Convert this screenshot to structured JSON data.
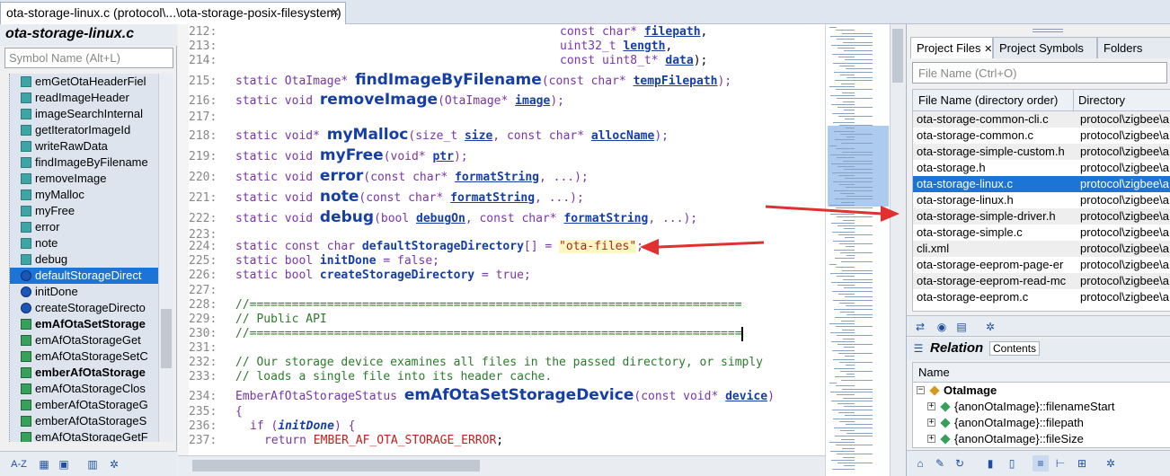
{
  "tab": {
    "title": "ota-storage-linux.c (protocol\\...\\ota-storage-posix-filesystem)",
    "close": "✕"
  },
  "left": {
    "title": "ota-storage-linux.c",
    "search_placeholder": "Symbol Name (Alt+L)",
    "symbols": [
      {
        "label": "emGetOtaHeaderFiel",
        "icon": "teal"
      },
      {
        "label": "readImageHeader",
        "icon": "teal"
      },
      {
        "label": "imageSearchInternal",
        "icon": "teal"
      },
      {
        "label": "getIteratorImageId",
        "icon": "teal"
      },
      {
        "label": "writeRawData",
        "icon": "teal"
      },
      {
        "label": "findImageByFilename",
        "icon": "teal"
      },
      {
        "label": "removeImage",
        "icon": "teal"
      },
      {
        "label": "myMalloc",
        "icon": "teal"
      },
      {
        "label": "myFree",
        "icon": "teal"
      },
      {
        "label": "error",
        "icon": "teal"
      },
      {
        "label": "note",
        "icon": "teal"
      },
      {
        "label": "debug",
        "icon": "teal"
      },
      {
        "label": "defaultStorageDirect",
        "icon": "blue",
        "selected": true
      },
      {
        "label": "initDone",
        "icon": "blue"
      },
      {
        "label": "createStorageDirecto",
        "icon": "blue"
      },
      {
        "label": "emAfOtaSetStorage",
        "icon": "green",
        "bold": true
      },
      {
        "label": "emAfOtaStorageGet",
        "icon": "green"
      },
      {
        "label": "emAfOtaStorageSetC",
        "icon": "green"
      },
      {
        "label": "emberAfOtaStorage",
        "icon": "green",
        "bold": true
      },
      {
        "label": "emAfOtaStorageClos",
        "icon": "green"
      },
      {
        "label": "emberAfOtaStorageG",
        "icon": "green"
      },
      {
        "label": "emberAfOtaStorageS",
        "icon": "green"
      },
      {
        "label": "emAfOtaStorageGetF",
        "icon": "green"
      }
    ],
    "toolbar": {
      "az": "A-Z"
    }
  },
  "code": {
    "l212": {
      "num": "212:",
      "text": "const char* ",
      "param": "filepath",
      "tail": ","
    },
    "l213": {
      "num": "213:",
      "text": "uint32_t ",
      "param": "length",
      "tail": ","
    },
    "l214": {
      "num": "214:",
      "text": "const uint8_t* ",
      "param": "data",
      "tail": ");"
    },
    "l215": {
      "num": "215:",
      "kw": "static OtaImage* ",
      "fn": "findImageByFilename",
      "open": "(",
      "args": "const char* ",
      "param": "tempFilepath",
      "tail": ");"
    },
    "l216": {
      "num": "216:",
      "kw": "static void ",
      "fn": "removeImage",
      "open": "(",
      "args": "OtaImage* ",
      "param": "image",
      "tail": ");"
    },
    "l217": {
      "num": "217:"
    },
    "l218": {
      "num": "218:",
      "kw": "static void* ",
      "fn": "myMalloc",
      "open": "(",
      "args": "size_t ",
      "param": "size",
      "mid": ", const char* ",
      "param2": "allocName",
      "tail": ");"
    },
    "l219": {
      "num": "219:",
      "kw": "static void ",
      "fn": "myFree",
      "open": "(",
      "args": "void* ",
      "param": "ptr",
      "tail": ");"
    },
    "l220": {
      "num": "220:",
      "kw": "static void ",
      "fn": "error",
      "open": "(",
      "args": "const char* ",
      "param": "formatString",
      "tail": ", ...);"
    },
    "l221": {
      "num": "221:",
      "kw": "static void ",
      "fn": "note",
      "open": "(",
      "args": "const char* ",
      "param": "formatString",
      "tail": ", ...);"
    },
    "l222": {
      "num": "222:",
      "kw": "static void ",
      "fn": "debug",
      "open": "(",
      "args": "bool ",
      "param": "debugOn",
      "mid": ", const char* ",
      "param2": "formatString",
      "tail": ", ...);"
    },
    "l223": {
      "num": "223:"
    },
    "l224": {
      "num": "224:",
      "kw": "static const char ",
      "name": "defaultStorageDirectory",
      "mid": "[] = ",
      "str": "\"ota-files\"",
      "tail": ";"
    },
    "l225": {
      "num": "225:",
      "kw": "static bool ",
      "name": "initDone",
      "tail": " = false;"
    },
    "l226": {
      "num": "226:",
      "kw": "static bool ",
      "name": "createStorageDirectory",
      "tail": " = true;"
    },
    "l227": {
      "num": "227:"
    },
    "l228": {
      "num": "228:",
      "cm": "//======================================================================"
    },
    "l229": {
      "num": "229:",
      "cm": "// Public API"
    },
    "l230": {
      "num": "230:",
      "cm": "//======================================================================"
    },
    "l231": {
      "num": "231:"
    },
    "l232": {
      "num": "232:",
      "cm": "// Our storage device examines all files in the passed directory, or simply"
    },
    "l233": {
      "num": "233:",
      "cm": "// loads a single file into its header cache."
    },
    "l234": {
      "num": "234:",
      "kw": "EmberAfOtaStorageStatus ",
      "fn": "emAfOtaSetStorageDevice",
      "open": "(",
      "args": "const void* ",
      "param": "device",
      "tail": ")"
    },
    "l235": {
      "num": "235:",
      "text": "{"
    },
    "l236": {
      "num": "236:",
      "kw": "if ",
      "open": "(",
      "bi": "initDone",
      "tail": ") {"
    },
    "l237": {
      "num": "237:",
      "kw": "return ",
      "cst": "EMBER_AF_OTA_STORAGE_ERROR",
      "tail": ";"
    }
  },
  "right": {
    "tabs": [
      "Project Files",
      "Project Symbols",
      "Folders"
    ],
    "tab_close": "✕",
    "search_placeholder": "File Name (Ctrl+O)",
    "columns": [
      "File Name (directory order)",
      "Directory"
    ],
    "files": [
      {
        "name": "ota-storage-common-cli.c",
        "dir": "protocol\\zigbee\\a"
      },
      {
        "name": "ota-storage-common.c",
        "dir": "protocol\\zigbee\\a"
      },
      {
        "name": "ota-storage-simple-custom.h",
        "dir": "protocol\\zigbee\\a"
      },
      {
        "name": "ota-storage.h",
        "dir": "protocol\\zigbee\\a"
      },
      {
        "name": "ota-storage-linux.c",
        "dir": "protocol\\zigbee\\a",
        "selected": true
      },
      {
        "name": "ota-storage-linux.h",
        "dir": "protocol\\zigbee\\a"
      },
      {
        "name": "ota-storage-simple-driver.h",
        "dir": "protocol\\zigbee\\a"
      },
      {
        "name": "ota-storage-simple.c",
        "dir": "protocol\\zigbee\\a"
      },
      {
        "name": "cli.xml",
        "dir": "protocol\\zigbee\\a"
      },
      {
        "name": "ota-storage-eeprom-page-er",
        "dir": "protocol\\zigbee\\a"
      },
      {
        "name": "ota-storage-eeprom-read-mc",
        "dir": "protocol\\zigbee\\a"
      },
      {
        "name": "ota-storage-eeprom.c",
        "dir": "protocol\\zigbee\\a"
      }
    ],
    "relation": {
      "title": "Relation",
      "contents_tab": "Contents",
      "column": "Name"
    },
    "tree": [
      {
        "label": "OtaImage",
        "root": true
      },
      {
        "label": "{anonOtaImage}::filenameStart"
      },
      {
        "label": "{anonOtaImage}::filepath"
      },
      {
        "label": "{anonOtaImage}::fileSize"
      }
    ]
  }
}
